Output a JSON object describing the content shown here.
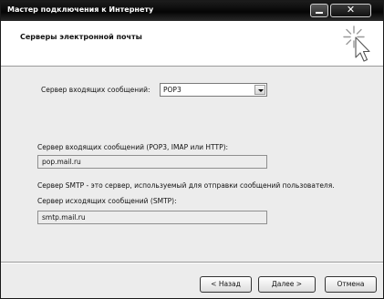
{
  "window": {
    "title": "Мастер подключения к Интернету",
    "close_glyph": "✕"
  },
  "header": {
    "title": "Серверы электронной почты"
  },
  "incoming_type": {
    "label": "Сервер входящих сообщений:",
    "value": "POP3"
  },
  "incoming_server": {
    "label": "Сервер входящих сообщений (POP3, IMAP или HTTP):",
    "value": "pop.mail.ru"
  },
  "smtp_note": "Сервер SMTP - это сервер, используемый для отправки сообщений  пользователя.",
  "outgoing_server": {
    "label": "Сервер исходящих сообщений (SMTP):",
    "value": "smtp.mail.ru"
  },
  "buttons": {
    "back_label": "< Назад",
    "next_label": "Далее >",
    "cancel_label": "Отмена"
  }
}
